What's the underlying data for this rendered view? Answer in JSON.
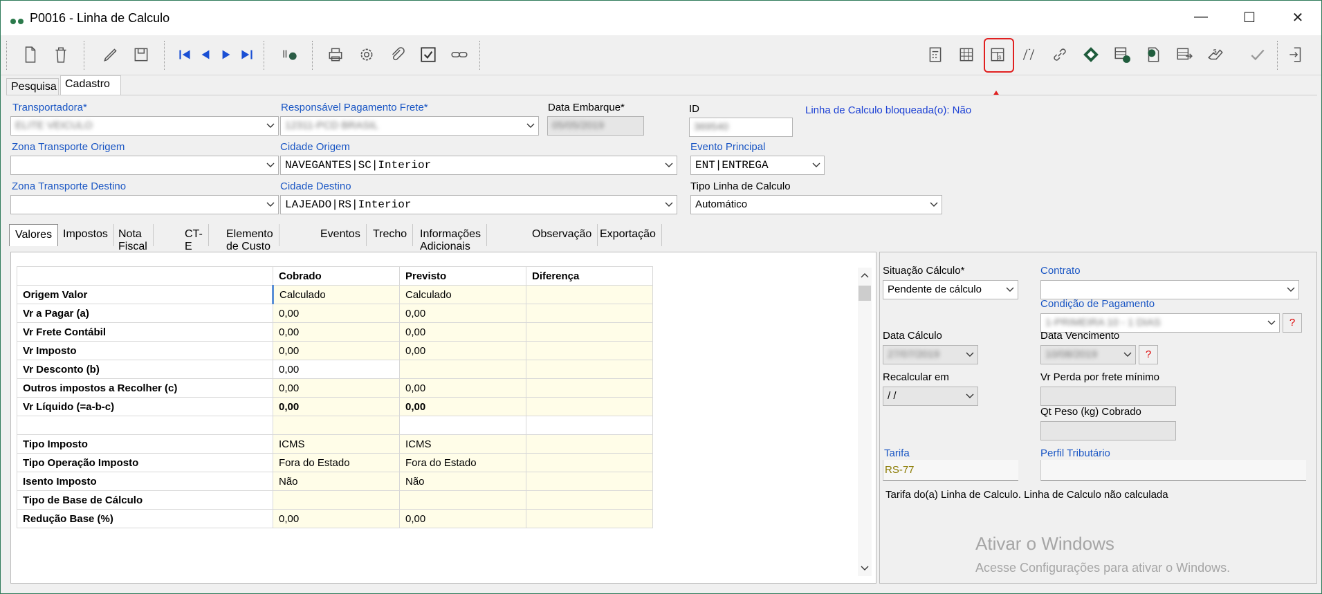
{
  "window": {
    "title": "P0016 - Linha de Calculo",
    "controls": {
      "minimize": "—",
      "maximize": "☐",
      "close": "✕"
    }
  },
  "toolbar_icons": [
    "new-document-icon",
    "delete-icon",
    "edit-icon",
    "save-icon",
    "first-record-icon",
    "previous-record-icon",
    "next-record-icon",
    "last-record-icon",
    "search-binoculars-icon",
    "print-icon",
    "settings-icon",
    "attachment-icon",
    "checkbox-icon",
    "link-icon",
    "calculator-icon",
    "calculator-grid-icon",
    "calculate-freight-icon",
    "formula-icon",
    "chain-link-icon",
    "diamond-icon",
    "table-check-icon",
    "document-money-icon",
    "table-arrow-icon",
    "hand-money-icon",
    "approve-check-icon",
    "exit-icon"
  ],
  "main_tabs": {
    "pesquisa": "Pesquisa",
    "cadastro": "Cadastro"
  },
  "form": {
    "transportadora": {
      "label": "Transportadora*",
      "value": "ELITE VEICULO"
    },
    "responsavel": {
      "label": "Responsável Pagamento Frete*",
      "value": "12311-PCD BRASIL"
    },
    "data_embarque": {
      "label": "Data Embarque*",
      "value": "05/05/2019"
    },
    "id": {
      "label": "ID",
      "value": "369540"
    },
    "bloqueada": "Linha de Calculo bloqueada(o): Não",
    "zona_origem": {
      "label": "Zona Transporte Origem",
      "value": ""
    },
    "cidade_origem": {
      "label": "Cidade Origem",
      "value": "NAVEGANTES|SC|Interior"
    },
    "evento_principal": {
      "label": "Evento Principal",
      "value": "ENT|ENTREGA"
    },
    "zona_destino": {
      "label": "Zona Transporte Destino",
      "value": ""
    },
    "cidade_destino": {
      "label": "Cidade Destino",
      "value": "LAJEADO|RS|Interior"
    },
    "tipo_linha": {
      "label": "Tipo Linha de Calculo",
      "value": "Automático"
    }
  },
  "sub_tabs": [
    "Valores",
    "Impostos",
    "Nota Fiscal",
    "CT-E",
    "Elemento de Custo",
    "Eventos",
    "Trecho",
    "Informações Adicionais",
    "Observação",
    "Exportação"
  ],
  "grid": {
    "headers": [
      "",
      "Cobrado",
      "Previsto",
      "Diferença"
    ],
    "rows": [
      {
        "label": "Origem Valor",
        "cobrado": "Calculado",
        "previsto": "Calculado",
        "diferenca": ""
      },
      {
        "label": "Vr a Pagar (a)",
        "cobrado": "0,00",
        "previsto": "0,00",
        "diferenca": ""
      },
      {
        "label": "Vr Frete Contábil",
        "cobrado": "0,00",
        "previsto": "0,00",
        "diferenca": ""
      },
      {
        "label": "Vr Imposto",
        "cobrado": "0,00",
        "previsto": "0,00",
        "diferenca": ""
      },
      {
        "label": "Vr Desconto (b)",
        "cobrado": "0,00",
        "previsto": "",
        "diferenca": ""
      },
      {
        "label": "Outros impostos a Recolher (c)",
        "cobrado": "0,00",
        "previsto": "0,00",
        "diferenca": ""
      },
      {
        "label": "Vr Líquido (=a-b-c)",
        "cobrado": "0,00",
        "previsto": "0,00",
        "diferenca": ""
      },
      {
        "label": "",
        "cobrado": "",
        "previsto": "",
        "diferenca": ""
      },
      {
        "label": "Tipo Imposto",
        "cobrado": "ICMS",
        "previsto": "ICMS",
        "diferenca": ""
      },
      {
        "label": "Tipo Operação Imposto",
        "cobrado": "Fora do Estado",
        "previsto": "Fora do Estado",
        "diferenca": ""
      },
      {
        "label": "Isento Imposto",
        "cobrado": "Não",
        "previsto": "Não",
        "diferenca": ""
      },
      {
        "label": "Tipo de Base de Cálculo",
        "cobrado": "",
        "previsto": "",
        "diferenca": ""
      },
      {
        "label": "Redução Base (%)",
        "cobrado": "0,00",
        "previsto": "0,00",
        "diferenca": ""
      }
    ]
  },
  "right_panel": {
    "situacao": {
      "label": "Situação Cálculo*",
      "value": "Pendente de cálculo"
    },
    "contrato": {
      "label": "Contrato",
      "value": ""
    },
    "condicao": {
      "label": "Condição de Pagamento",
      "value": "1-PRIMEIRA 10 - 1 DIAS"
    },
    "data_calculo": {
      "label": "Data Cálculo",
      "value": "27/07/2019"
    },
    "data_vencimento": {
      "label": "Data Vencimento",
      "value": "10/08/2019"
    },
    "recalcular": {
      "label": "Recalcular em",
      "value": " / /"
    },
    "vr_perda": {
      "label": "Vr Perda por frete mínimo",
      "value": ""
    },
    "qt_peso": {
      "label": "Qt Peso (kg) Cobrado",
      "value": ""
    },
    "tarifa": {
      "label": "Tarifa",
      "value": "RS-77"
    },
    "perfil": {
      "label": "Perfil Tributário",
      "value": ""
    },
    "tarifa_note": "Tarifa do(a) Linha de Calculo. Linha de Calculo não calculada",
    "question": "?"
  },
  "watermark": {
    "title": "Ativar o Windows",
    "subtitle": "Acesse Configurações para ativar o Windows."
  },
  "colors": {
    "highlight": "#e02020",
    "link": "#1a56c4",
    "accent": "#2b7a4b"
  }
}
